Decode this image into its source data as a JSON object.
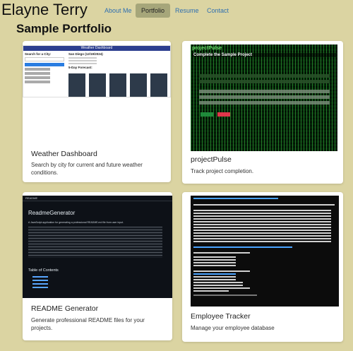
{
  "nav": {
    "brand": "Elayne Terry",
    "links": [
      {
        "label": "About Me",
        "active": false
      },
      {
        "label": "Portfolio",
        "active": true
      },
      {
        "label": "Resume",
        "active": false
      },
      {
        "label": "Contact",
        "active": false
      }
    ]
  },
  "page": {
    "title": "Sample Portfolio"
  },
  "projects": [
    {
      "title": "Weather Dashboard",
      "description": "Search by city for current and future weather conditions.",
      "thumbnail": {
        "header": "Weather Dashboard",
        "search_label": "Search for a City:",
        "city": "San Diego (12/19/2024)",
        "forecast_label": "5-Day Forecast:"
      }
    },
    {
      "title": "projectPulse",
      "description": "Track project completion.",
      "thumbnail": {
        "app_name": "projectPulse",
        "heading": "Complete the Sample Project"
      }
    },
    {
      "title": "README Generator",
      "description": "Generate professional README files for your projects.",
      "thumbnail": {
        "file_label": "README",
        "heading": "ReadmeGenerator",
        "intro": "A JavaScript application for generating a professional README.md file from user input.",
        "toc_heading": "Table of Contents"
      }
    },
    {
      "title": "Employee Tracker",
      "description": "Manage your employee database",
      "thumbnail": {
        "prompt": "What would you like to do? View All Employees"
      }
    }
  ],
  "colors": {
    "background": "#dbd4a2",
    "nav_active": "#a6a67a",
    "link": "#2f6fb0"
  }
}
